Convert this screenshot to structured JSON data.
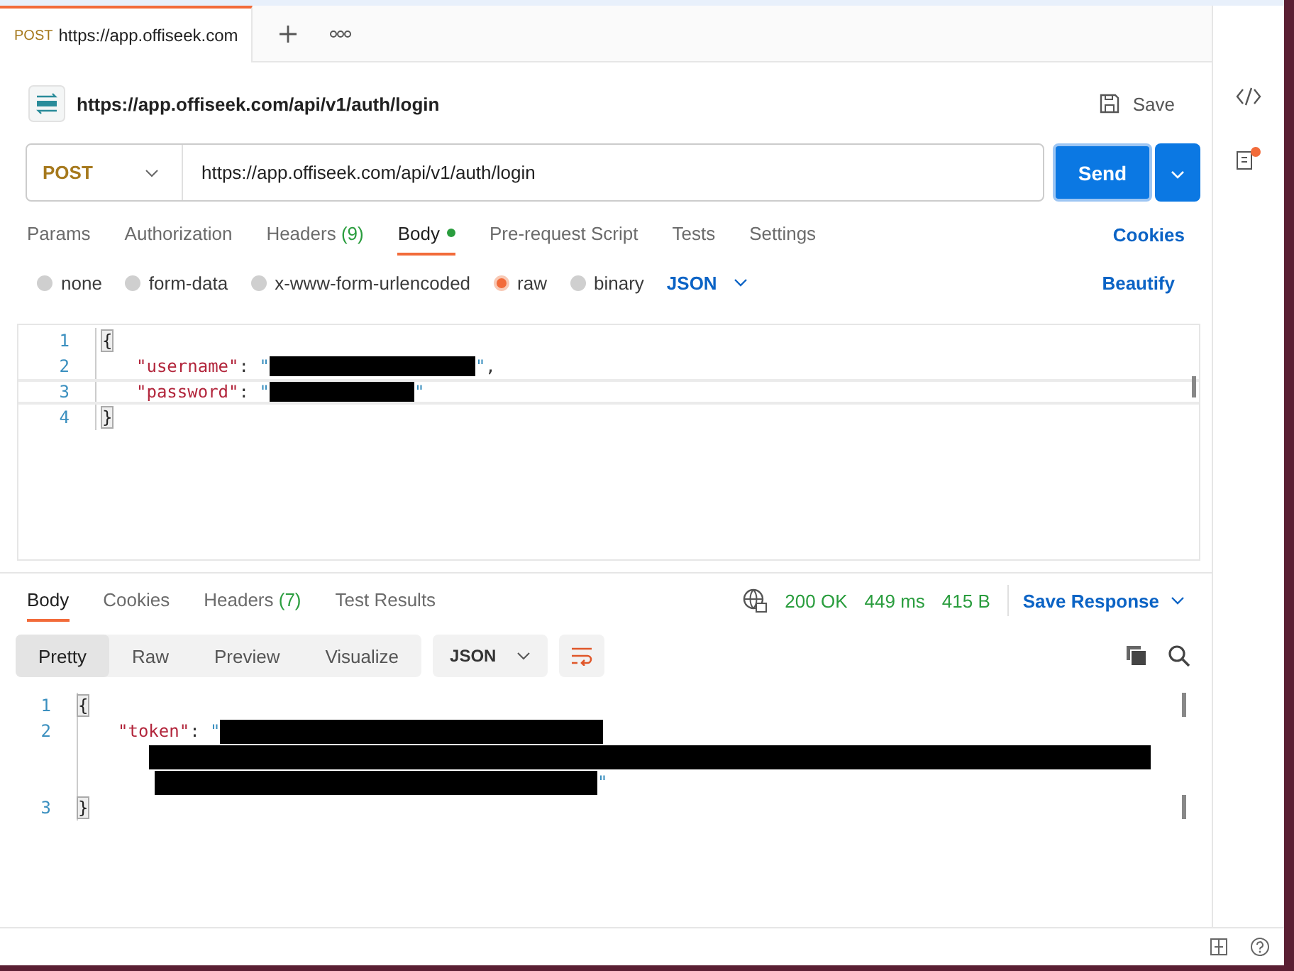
{
  "tabs": [
    {
      "method": "POST",
      "label": "https://app.offiseek.com",
      "selected": true
    }
  ],
  "request": {
    "title": "https://app.offiseek.com/api/v1/auth/login",
    "save": "Save",
    "method": "POST",
    "url": "https://app.offiseek.com/api/v1/auth/login",
    "send": "Send"
  },
  "request_tabs": [
    {
      "label": "Params",
      "selected": false
    },
    {
      "label": "Authorization",
      "selected": false
    },
    {
      "label": "Headers",
      "count": "(9)",
      "selected": false
    },
    {
      "label": "Body",
      "selected": true,
      "dot": true
    },
    {
      "label": "Pre-request Script",
      "selected": false
    },
    {
      "label": "Tests",
      "selected": false
    },
    {
      "label": "Settings",
      "selected": false
    }
  ],
  "cookies": "Cookies",
  "body_types": [
    {
      "label": "none",
      "selected": false
    },
    {
      "label": "form-data",
      "selected": false
    },
    {
      "label": "x-www-form-urlencoded",
      "selected": false
    },
    {
      "label": "raw",
      "selected": true
    },
    {
      "label": "binary",
      "selected": false
    }
  ],
  "body_format": "JSON",
  "beautify": "Beautify",
  "request_code": [
    {
      "number": "1",
      "active": false,
      "tokens": [
        {
          "kind": "brace",
          "text": "{"
        }
      ]
    },
    {
      "number": "2",
      "active": false,
      "tokens": [
        {
          "kind": "key",
          "text": "\"username\""
        },
        {
          "kind": "punct",
          "text": ": "
        },
        {
          "kind": "string",
          "text": "\""
        },
        {
          "kind": "redacted"
        },
        {
          "kind": "string",
          "text": "\""
        },
        {
          "kind": "punct",
          "text": ","
        }
      ]
    },
    {
      "number": "3",
      "active": true,
      "tokens": [
        {
          "kind": "key",
          "text": "\"password\""
        },
        {
          "kind": "punct",
          "text": ": "
        },
        {
          "kind": "string",
          "text": "\""
        },
        {
          "kind": "redacted"
        },
        {
          "kind": "string",
          "text": "\""
        }
      ]
    },
    {
      "number": "4",
      "active": false,
      "tokens": [
        {
          "kind": "brace",
          "text": "}"
        }
      ]
    }
  ],
  "response_tabs": [
    {
      "label": "Body",
      "selected": true
    },
    {
      "label": "Cookies",
      "selected": false
    },
    {
      "label": "Headers",
      "count": "(7)",
      "selected": false
    },
    {
      "label": "Test Results",
      "selected": false
    }
  ],
  "status": {
    "code": "200 OK",
    "time": "449 ms",
    "size": "415 B"
  },
  "save_response": "Save Response",
  "view_modes": [
    {
      "label": "Pretty",
      "selected": true
    },
    {
      "label": "Raw",
      "selected": false
    },
    {
      "label": "Preview",
      "selected": false
    },
    {
      "label": "Visualize",
      "selected": false
    }
  ],
  "response_format": "JSON",
  "response_code": [
    {
      "number": "1",
      "tokens": [
        {
          "kind": "brace",
          "text": "{"
        }
      ]
    },
    {
      "number": "2",
      "tokens": [
        {
          "kind": "key",
          "text": "\"token\""
        },
        {
          "kind": "punct",
          "text": ": "
        },
        {
          "kind": "string",
          "text": "\""
        },
        {
          "kind": "redacted"
        }
      ]
    },
    {
      "tokens": [
        {
          "kind": "redacted"
        }
      ]
    },
    {
      "tokens": [
        {
          "kind": "redacted"
        },
        {
          "kind": "string",
          "text": "\""
        }
      ]
    },
    {
      "number": "3",
      "tokens": [
        {
          "kind": "brace",
          "text": "}"
        }
      ]
    }
  ]
}
